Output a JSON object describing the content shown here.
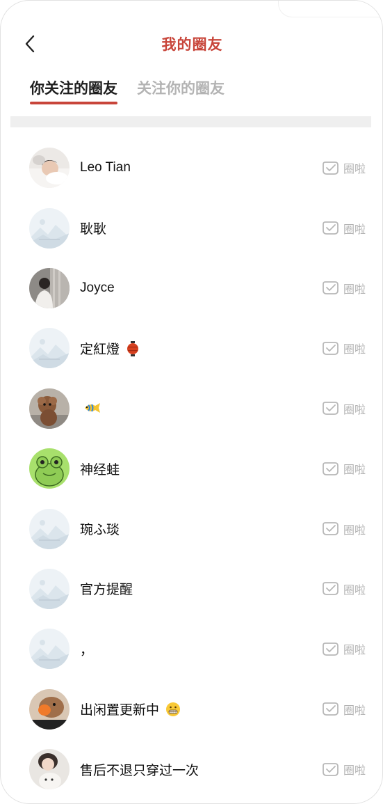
{
  "nav": {
    "title": "我的圈友",
    "back_icon": "chevron-left-icon"
  },
  "tabs": [
    {
      "label": "你关注的圈友",
      "active": true
    },
    {
      "label": "关注你的圈友",
      "active": false
    }
  ],
  "colors": {
    "accent": "#c8453a",
    "inactive_text": "#b3b3b3",
    "divider": "#efefef"
  },
  "friends": [
    {
      "name": "Leo Tian",
      "avatar": "photo-baby-avatar",
      "action_label": "圈啦",
      "action_icon": "wave-hand-icon"
    },
    {
      "name": "耿耿",
      "avatar": "default-placeholder-avatar",
      "action_label": "圈啦",
      "action_icon": "wave-hand-icon"
    },
    {
      "name": "Joyce",
      "avatar": "photo-person-avatar",
      "action_label": "圈啦",
      "action_icon": "wave-hand-icon"
    },
    {
      "name": "定紅燈",
      "name_emoji": "lantern-emoji",
      "avatar": "default-placeholder-avatar",
      "action_label": "圈啦",
      "action_icon": "wave-hand-icon"
    },
    {
      "name": "",
      "name_emoji": "fish-emoji",
      "avatar": "photo-dog-avatar",
      "action_label": "圈啦",
      "action_icon": "wave-hand-icon"
    },
    {
      "name": "神经蛙",
      "avatar": "cartoon-frog-avatar",
      "action_label": "圈啦",
      "action_icon": "wave-hand-icon"
    },
    {
      "name": "琬ふ琰",
      "avatar": "default-placeholder-avatar",
      "action_label": "圈啦",
      "action_icon": "wave-hand-icon"
    },
    {
      "name": "官方提醒",
      "avatar": "default-placeholder-avatar",
      "action_label": "圈啦",
      "action_icon": "wave-hand-icon"
    },
    {
      "name": "，",
      "avatar": "default-placeholder-avatar",
      "action_label": "圈啦",
      "action_icon": "wave-hand-icon"
    },
    {
      "name": "出闲置更新中",
      "name_emoji": "grimace-emoji",
      "avatar": "photo-dog-mask-avatar",
      "action_label": "圈啦",
      "action_icon": "wave-hand-icon"
    },
    {
      "name": "售后不退只穿过一次",
      "avatar": "photo-girl-cat-avatar",
      "action_label": "圈啦",
      "action_icon": "wave-hand-icon"
    }
  ]
}
